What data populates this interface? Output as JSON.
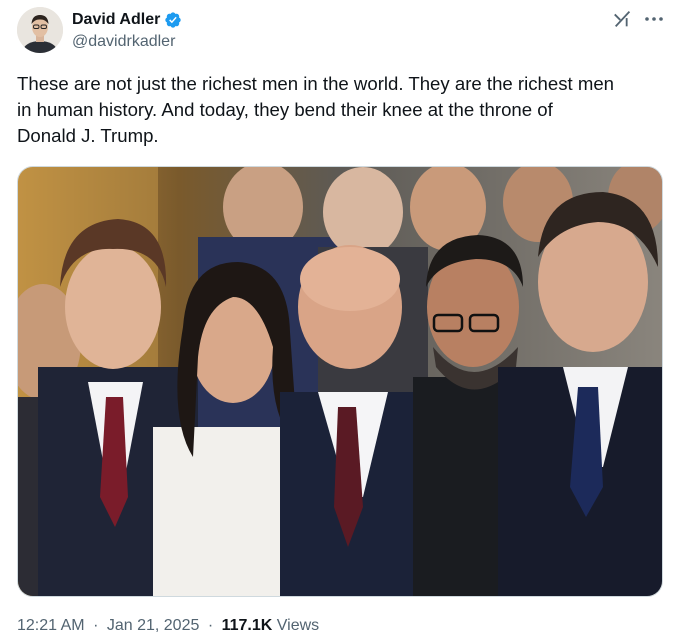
{
  "author": {
    "display_name": "David Adler",
    "handle": "@davidrkadler",
    "verified": true,
    "verified_color": "#1d9bf0",
    "avatar_icon": "user-avatar"
  },
  "header_actions": {
    "grok_icon": "grok-icon",
    "more_icon": "more-icon"
  },
  "tweet": {
    "text_lines": [
      "These are not just the richest men in the world. They are the richest men",
      "in human history. And today, they bend their knee at the throne of",
      "Donald J. Trump."
    ]
  },
  "photo": {
    "content": "photo"
  },
  "meta": {
    "time": "12:21 AM",
    "separator": "·",
    "date": "Jan 21, 2025",
    "views_count": "117.1K",
    "views_label": "Views"
  }
}
